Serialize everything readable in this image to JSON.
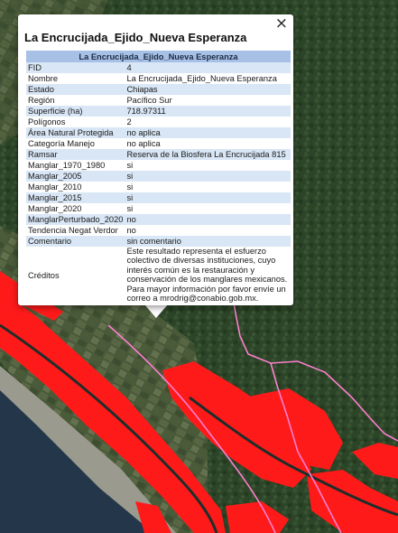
{
  "popup": {
    "title": "La Encrucijada_Ejido_Nueva Esperanza",
    "close_label": "×",
    "table_header": "La Encrucijada_Ejido_Nueva Esperanza",
    "rows": [
      {
        "key": "FID",
        "value": "4"
      },
      {
        "key": "Nombre",
        "value": "La Encrucijada_Ejido_Nueva Esperanza"
      },
      {
        "key": "Estado",
        "value": "Chiapas"
      },
      {
        "key": "Región",
        "value": "Pacífico Sur"
      },
      {
        "key": "Superficie (ha)",
        "value": "718.97311"
      },
      {
        "key": "Polígonos",
        "value": "2"
      },
      {
        "key": "Área Natural Protegida",
        "value": "no aplica"
      },
      {
        "key": "Categoría Manejo",
        "value": "no aplica"
      },
      {
        "key": "Ramsar",
        "value": "Reserva de la Biosfera La Encrucijada 815"
      },
      {
        "key": "Manglar_1970_1980",
        "value": "si"
      },
      {
        "key": "Manglar_2005",
        "value": "si"
      },
      {
        "key": "Manglar_2010",
        "value": "si"
      },
      {
        "key": "Manglar_2015",
        "value": "si"
      },
      {
        "key": "Manglar_2020",
        "value": "si"
      },
      {
        "key": "ManglarPerturbado_2020",
        "value": "no"
      },
      {
        "key": "Tendencia Negat Verdor",
        "value": "no"
      },
      {
        "key": "Comentario",
        "value": "sin comentario"
      },
      {
        "key": "Créditos",
        "value": "Este resultado representa el esfuerzo colectivo de diversas instituciones, cuyo interés común es la restauración y conservación de los manglares mexicanos. Para mayor información por favor envíe un correo a mrodrig@conabio.gob.mx."
      }
    ]
  },
  "map": {
    "mangrove_color": "#ff1a1a",
    "boundary_color": "#ff7fd0",
    "vegetation_color": "#2f4a2a",
    "ocean_color": "#24364a",
    "beach_color": "#9a9a8e"
  }
}
